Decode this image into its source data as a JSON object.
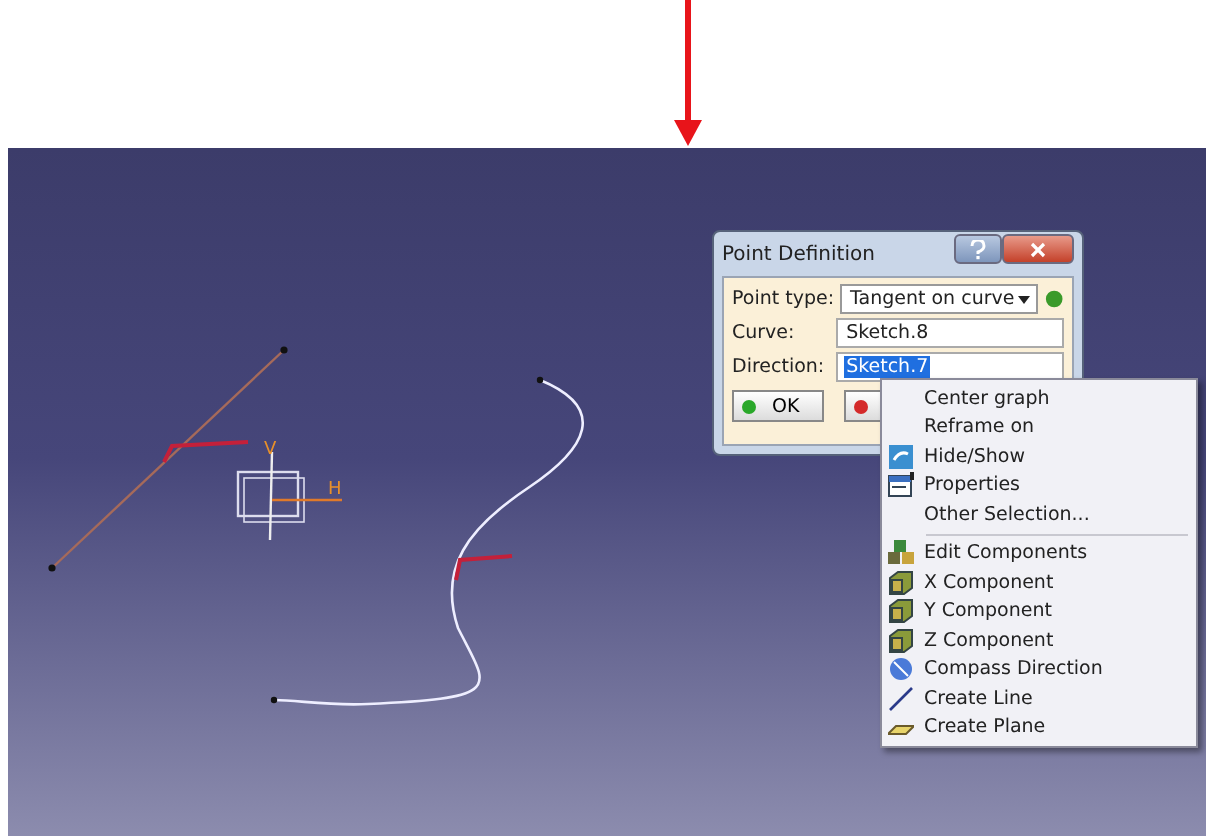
{
  "viewport": {
    "axis_labels": [
      "V",
      "H"
    ]
  },
  "dialog": {
    "title": "Point Definition",
    "fields": [
      {
        "kind": "combo",
        "label": "Point type:",
        "value": "Tangent on curve",
        "selected": false
      },
      {
        "kind": "text",
        "label": "Curve:",
        "value": "Sketch.8",
        "selected": false
      },
      {
        "kind": "text",
        "label": "Direction:",
        "value": "Sketch.7",
        "selected": true
      }
    ],
    "buttons": [
      {
        "kind": "ok",
        "label": "OK"
      },
      {
        "kind": "cancel"
      }
    ]
  },
  "context_menu": {
    "items": [
      {
        "kind": "plain",
        "label": "Center graph"
      },
      {
        "kind": "plain",
        "label": "Reframe on"
      },
      {
        "kind": "hideshow",
        "label": "Hide/Show"
      },
      {
        "kind": "properties",
        "label": "Properties"
      },
      {
        "kind": "plain",
        "label": "Other Selection..."
      },
      {
        "kind": "edit",
        "label": "Edit Components",
        "separator_before": true
      },
      {
        "kind": "component",
        "label": "X Component"
      },
      {
        "kind": "component",
        "label": "Y Component"
      },
      {
        "kind": "component",
        "label": "Z Component"
      },
      {
        "kind": "compass",
        "label": "Compass Direction"
      },
      {
        "kind": "line",
        "label": "Create Line"
      },
      {
        "kind": "plane",
        "label": "Create Plane"
      }
    ]
  }
}
